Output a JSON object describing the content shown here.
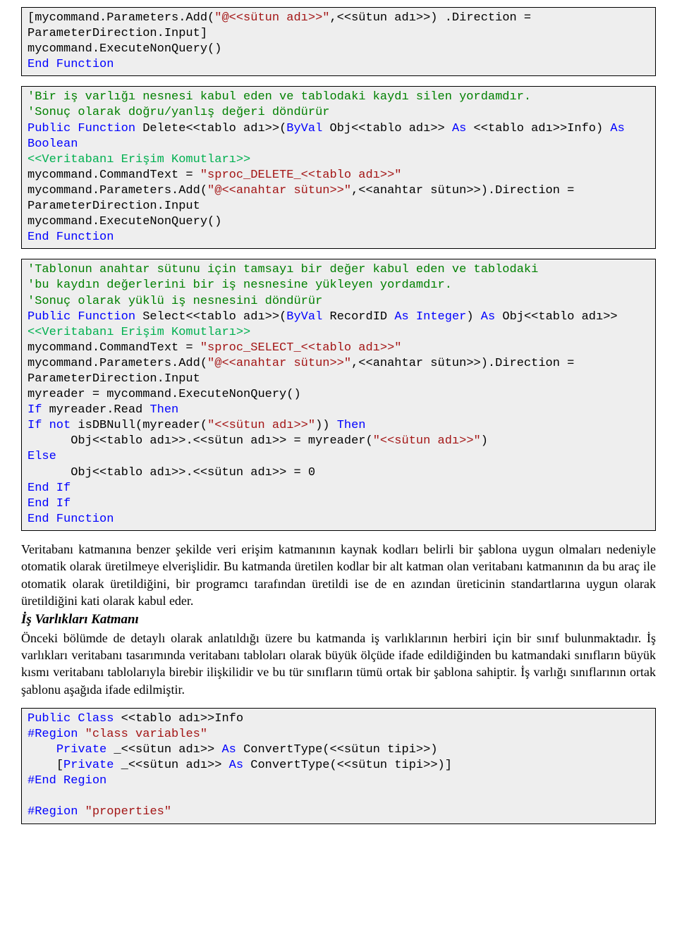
{
  "block1": {
    "l1a": "[mycommand.Parameters.Add(",
    "l1b": "\"@<<sütun adı>>\"",
    "l1c": ",<<sütun adı>>) .Direction = ParameterDirection.Input]",
    "l2": "mycommand.ExecuteNonQuery()",
    "l3": "End Function"
  },
  "block2": {
    "c1": "'Bir iş varlığı nesnesi kabul eden ve tablodaki kaydı silen yordamdır.",
    "c2": "'Sonuç olarak doğru/yanlış değeri döndürür",
    "d1a": "Public Function",
    "d1b": " Delete<<tablo adı>>(",
    "d1c": "ByVal",
    "d1d": " Obj<<tablo adı>> ",
    "d1e": "As",
    "d1f": " <<tablo adı>>Info) ",
    "d1g": "As Boolean",
    "dbacc": "<<Veritabanı Erişim Komutları>>",
    "cta": "mycommand.CommandText = ",
    "ctb": "\"sproc_DELETE_<<tablo adı>>\"",
    "pa": "mycommand.Parameters.Add(",
    "pb": "\"@<<anahtar sütun>>\"",
    "pc": ",<<anahtar sütun>>).Direction = ParameterDirection.Input",
    "exec": "mycommand.ExecuteNonQuery()",
    "endf": "End Function"
  },
  "block3": {
    "c1": "'Tablonun anahtar sütunu için tamsayı bir değer kabul eden ve tablodaki",
    "c2": "'bu kaydın değerlerini bir iş nesnesine yükleyen yordamdır.",
    "c3": "'Sonuç olarak yüklü iş nesnesini döndürür",
    "d1a": "Public Function",
    "d1b": " Select<<tablo adı>>(",
    "d1c": "ByVal",
    "d1d": " RecordID ",
    "d1e": "As Integer",
    "d1f": ") ",
    "d1g": "As",
    "d1h": " Obj<<tablo adı>>",
    "dbacc": "<<Veritabanı Erişim Komutları>>",
    "cta": "mycommand.CommandText = ",
    "ctb": "\"sproc_SELECT_<<tablo adı>>\"",
    "pa": "mycommand.Parameters.Add(",
    "pb": "\"@<<anahtar sütun>>\"",
    "pc": ",<<anahtar sütun>>).Direction = ParameterDirection.Input",
    "rdr": "myreader = mycommand.ExecuteNonQuery()",
    "if1a": "If",
    "if1b": " myreader.Read ",
    "if1c": "Then",
    "if2a": "If not",
    "if2b": " isDBNull(myreader(",
    "if2c": "\"<<sütun adı>>\"",
    "if2d": ")) ",
    "if2e": "Then",
    "assigna": "      Obj<<tablo adı>>.<<sütun adı>> = myreader(",
    "assignb": "\"<<sütun adı>>\"",
    "assignc": ")",
    "else": "Else",
    "assign0": "      Obj<<tablo adı>>.<<sütun adı>> = 0",
    "endif": "End If",
    "endf": "End Function"
  },
  "para1": "Veritabanı katmanına benzer şekilde veri erişim katmanının kaynak kodları belirli bir şablona uygun olmaları nedeniyle otomatik olarak üretilmeye elverişlidir. Bu katmanda üretilen kodlar bir alt katman olan veritabanı katmanının da bu araç ile otomatik olarak üretildiğini, bir programcı tarafından üretildi ise de en azından üreticinin standartlarına uygun olarak üretildiğini kati olarak kabul eder.",
  "heading1": "İş Varlıkları Katmanı",
  "para2": "Önceki bölümde de detaylı olarak anlatıldığı üzere bu katmanda iş varlıklarının herbiri için bir sınıf bulunmaktadır. İş varlıkları veritabanı tasarımında veritabanı tabloları olarak büyük ölçüde ifade edildiğinden bu katmandaki sınıfların büyük kısmı veritabanı tablolarıyla birebir ilişkilidir ve bu tür sınıfların tümü ortak bir şablona sahiptir. İş varlığı sınıflarının ortak şablonu aşağıda ifade edilmiştir.",
  "block4": {
    "l1a": "Public Class",
    "l1b": " <<tablo adı>>Info",
    "r1a": "#Region ",
    "r1b": "\"class variables\"",
    "pv1a": "    Private",
    "pv1b": " _<<sütun adı>> ",
    "pv1c": "As",
    "pv1d": " ConvertType(<<sütun tipi>>)",
    "pv2a": "    [",
    "pv2b": "Private",
    "pv2c": " _<<sütun adı>> ",
    "pv2d": "As",
    "pv2e": " ConvertType(<<sütun tipi>>)]",
    "endr": "#End Region",
    "blank": "",
    "r2a": "#Region ",
    "r2b": "\"properties\""
  }
}
